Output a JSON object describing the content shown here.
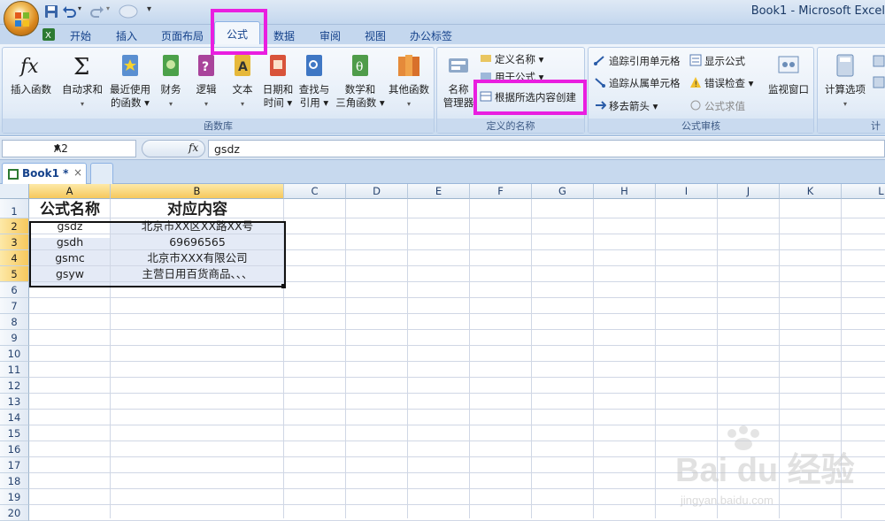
{
  "window": {
    "title": "Book1 - Microsoft Excel"
  },
  "tabs": [
    "开始",
    "插入",
    "页面布局",
    "公式",
    "数据",
    "审阅",
    "视图",
    "办公标签"
  ],
  "active_tab": "公式",
  "ribbon": {
    "function_library": {
      "label": "函数库",
      "buttons": [
        {
          "line1": "插入函数",
          "line2": ""
        },
        {
          "line1": "自动求和",
          "line2": "▾"
        },
        {
          "line1": "最近使用",
          "line2": "的函数 ▾"
        },
        {
          "line1": "财务",
          "line2": "▾"
        },
        {
          "line1": "逻辑",
          "line2": "▾"
        },
        {
          "line1": "文本",
          "line2": "▾"
        },
        {
          "line1": "日期和",
          "line2": "时间 ▾"
        },
        {
          "line1": "查找与",
          "line2": "引用 ▾"
        },
        {
          "line1": "数学和",
          "line2": "三角函数 ▾"
        },
        {
          "line1": "其他函数",
          "line2": "▾"
        }
      ]
    },
    "defined_names": {
      "label": "定义的名称",
      "name_manager_line1": "名称",
      "name_manager_line2": "管理器",
      "define_name": "定义名称 ▾",
      "use_in_formula": "用于公式 ▾",
      "create_from_selection": "根据所选内容创建"
    },
    "formula_auditing": {
      "label": "公式审核",
      "trace_precedents": "追踪引用单元格",
      "trace_dependents": "追踪从属单元格",
      "remove_arrows": "移去箭头 ▾",
      "show_formulas": "显示公式",
      "error_checking": "错误检查 ▾",
      "evaluate_formula": "公式求值",
      "watch_window": "监视窗口"
    },
    "calculation": {
      "label": "计",
      "calc_options": "计算选项",
      "calc_options_arrow": "▾"
    }
  },
  "formula_bar": {
    "name_box": "A2",
    "fx": "fx",
    "formula": "gsdz"
  },
  "workbook_tab": {
    "name": "Book1 *",
    "close": "×"
  },
  "columns": [
    "A",
    "B",
    "C",
    "D",
    "E",
    "F",
    "G",
    "H",
    "I",
    "J",
    "K",
    "L"
  ],
  "rows": [
    "1",
    "2",
    "3",
    "4",
    "5",
    "6",
    "7",
    "8",
    "9",
    "10",
    "11",
    "12",
    "13",
    "14",
    "15",
    "16",
    "17",
    "18",
    "19",
    "20"
  ],
  "table": {
    "headers": [
      "公式名称",
      "对应内容"
    ],
    "rows": [
      [
        "gsdz",
        "北京市XX区XX路XX号"
      ],
      [
        "gsdh",
        "69696565"
      ],
      [
        "gsmc",
        "北京市XXX有限公司"
      ],
      [
        "gsyw",
        "主营日用百货商品、、、"
      ]
    ]
  },
  "watermark": {
    "brand": "Bai du 经验",
    "url": "jingyan.baidu.com"
  },
  "colors": {
    "highlight": "#e91ee0",
    "accent": "#15428b"
  }
}
